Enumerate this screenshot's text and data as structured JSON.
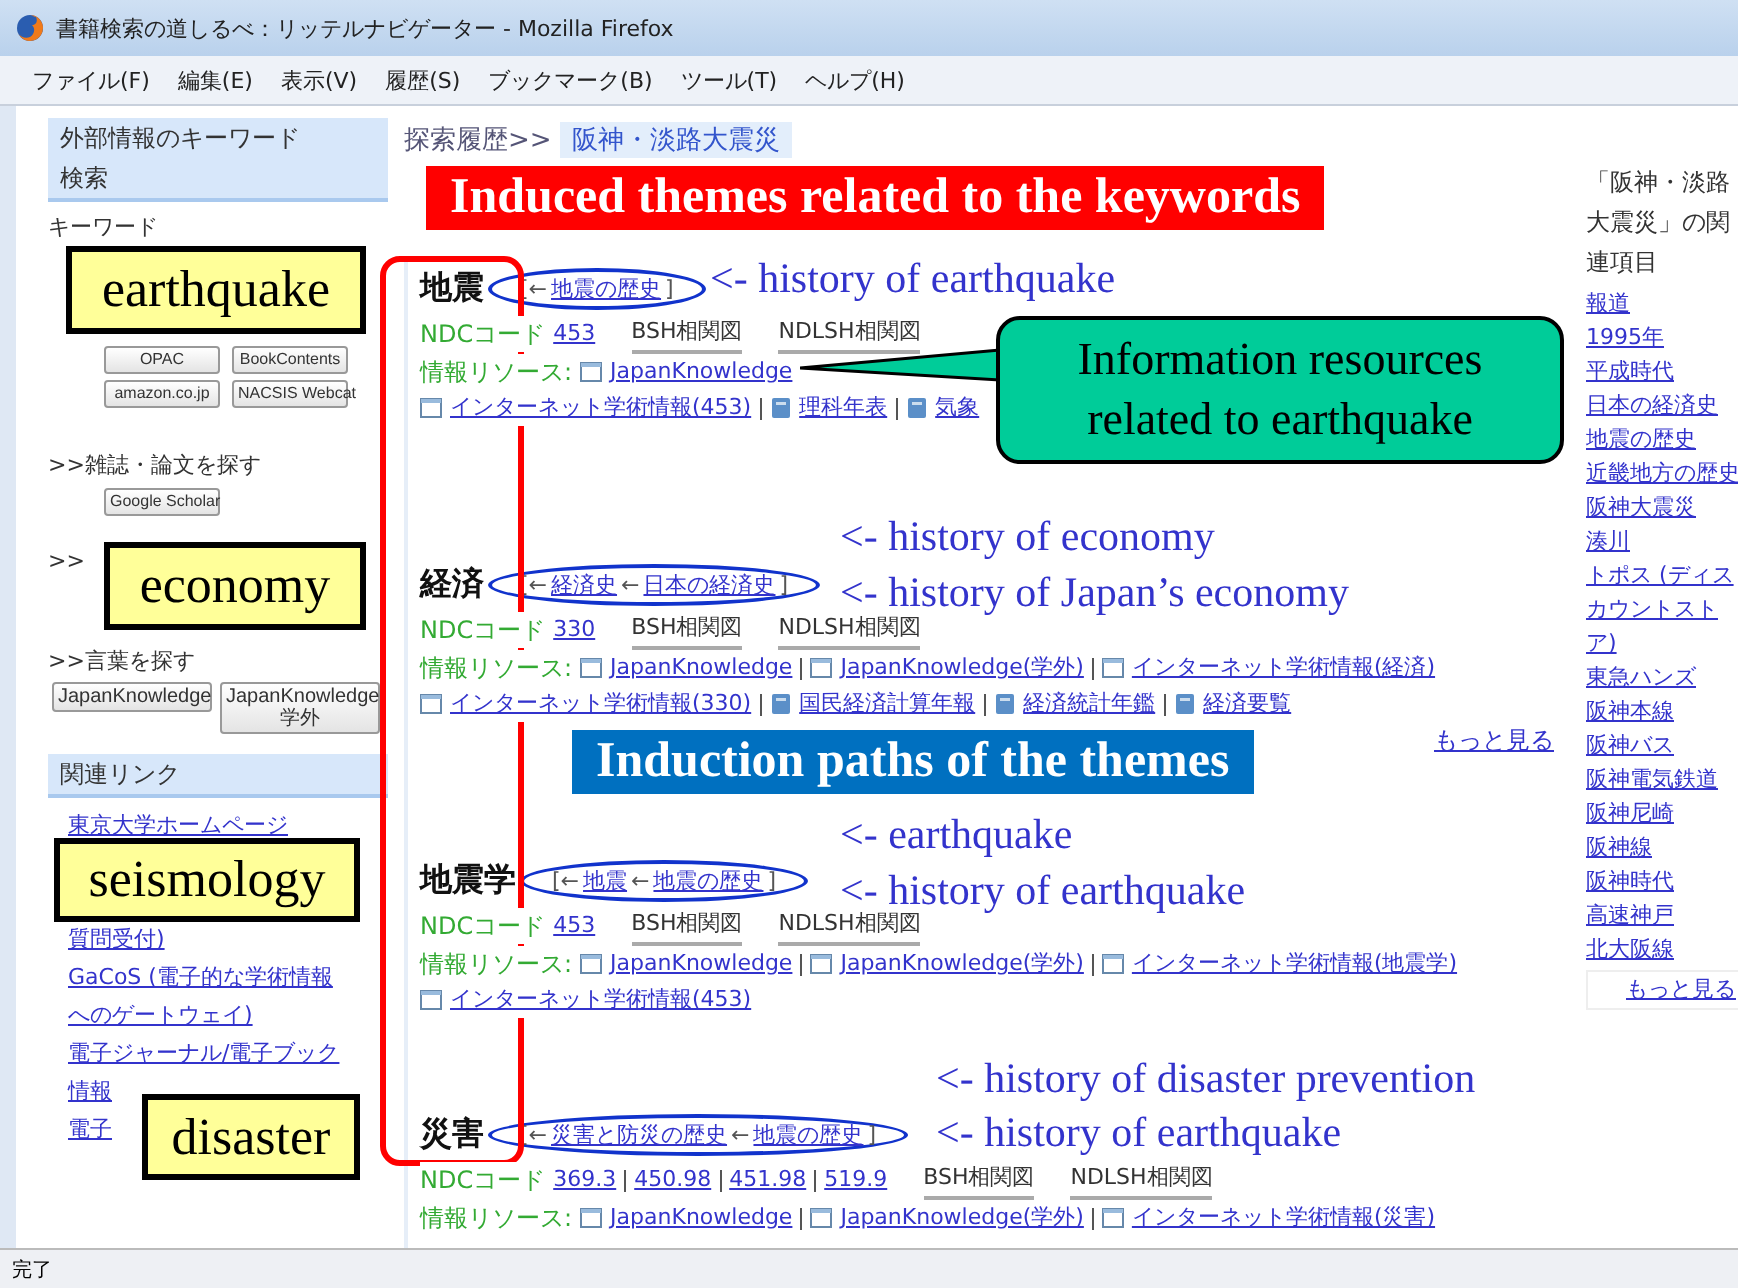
{
  "window": {
    "title": "書籍検索の道しるべ：リッテルナビゲーター - Mozilla Firefox"
  },
  "menu": [
    "ファイル(F)",
    "編集(E)",
    "表示(V)",
    "履歴(S)",
    "ブックマーク(B)",
    "ツール(T)",
    "ヘルプ(H)"
  ],
  "sidebar": {
    "search_heading": "外部情報のキーワード検索",
    "keyword_label": "キーワード",
    "catalog_buttons": [
      "OPAC",
      "BookContents",
      "amazon.co.jp",
      "NACSIS Webcat"
    ],
    "article_label": ">>雑誌・論文を探す",
    "article_buttons": [
      "Google Scholar"
    ],
    "hidden_label": ">>",
    "word_label": ">>言葉を探す",
    "word_buttons": [
      "JapanKnowledge",
      "JapanKnowledge 学外"
    ],
    "links_heading": "関連リンク",
    "links": [
      "東京大学ホームページ",
      "質問受付)",
      "GaCoS (電子的な学術情報へのゲートウェイ)",
      "電子ジャーナル/電子ブック",
      "情報",
      "電子"
    ]
  },
  "main": {
    "breadcrumb": {
      "label": "探索履歴>>",
      "current": "阪神・淡路大震災"
    },
    "themes": [
      {
        "name": "地震",
        "path": [
          {
            "kind": "text",
            "text": "[←"
          },
          {
            "kind": "link",
            "text": "地震の歴史"
          },
          {
            "kind": "text",
            "text": "]"
          }
        ],
        "ndc_label": "NDCコード",
        "ndc_codes": [
          "453"
        ],
        "maps": [
          "BSH相関図",
          "NDLSH相関図"
        ],
        "resources_label": "情報リソース:",
        "resource_lines": [
          [
            {
              "kind": "web",
              "label": "JapanKnowledge"
            }
          ],
          [
            {
              "kind": "web",
              "label": "インターネット学術情報(453)"
            },
            {
              "kind": "book",
              "label": "理科年表"
            },
            {
              "kind": "book",
              "label": "気象"
            }
          ]
        ]
      },
      {
        "name": "経済",
        "path": [
          {
            "kind": "text",
            "text": "[←"
          },
          {
            "kind": "link",
            "text": "経済史"
          },
          {
            "kind": "text",
            "text": "←"
          },
          {
            "kind": "link",
            "text": "日本の経済史"
          },
          {
            "kind": "text",
            "text": "]"
          }
        ],
        "ndc_label": "NDCコード",
        "ndc_codes": [
          "330"
        ],
        "maps": [
          "BSH相関図",
          "NDLSH相関図"
        ],
        "resources_label": "情報リソース:",
        "resource_lines": [
          [
            {
              "kind": "web",
              "label": "JapanKnowledge"
            },
            {
              "kind": "web",
              "label": "JapanKnowledge(学外)"
            },
            {
              "kind": "web",
              "label": "インターネット学術情報(経済)"
            }
          ],
          [
            {
              "kind": "web",
              "label": "インターネット学術情報(330)"
            },
            {
              "kind": "book",
              "label": "国民経済計算年報"
            },
            {
              "kind": "book",
              "label": "経済統計年鑑"
            },
            {
              "kind": "book",
              "label": "経済要覧"
            }
          ]
        ],
        "more": "もっと見る"
      },
      {
        "name": "地震学",
        "path": [
          {
            "kind": "text",
            "text": "[←"
          },
          {
            "kind": "link",
            "text": "地震"
          },
          {
            "kind": "text",
            "text": "←"
          },
          {
            "kind": "link",
            "text": "地震の歴史"
          },
          {
            "kind": "text",
            "text": "]"
          }
        ],
        "ndc_label": "NDCコード",
        "ndc_codes": [
          "453"
        ],
        "maps": [
          "BSH相関図",
          "NDLSH相関図"
        ],
        "resources_label": "情報リソース:",
        "resource_lines": [
          [
            {
              "kind": "web",
              "label": "JapanKnowledge"
            },
            {
              "kind": "web",
              "label": "JapanKnowledge(学外)"
            },
            {
              "kind": "web",
              "label": "インターネット学術情報(地震学)"
            }
          ],
          [
            {
              "kind": "web",
              "label": "インターネット学術情報(453)"
            }
          ]
        ]
      },
      {
        "name": "災害",
        "path": [
          {
            "kind": "text",
            "text": "[←"
          },
          {
            "kind": "link",
            "text": "災害と防災の歴史"
          },
          {
            "kind": "text",
            "text": "←"
          },
          {
            "kind": "link",
            "text": "地震の歴史"
          },
          {
            "kind": "text",
            "text": "]"
          }
        ],
        "ndc_label": "NDCコード",
        "ndc_codes": [
          "369.3",
          "450.98",
          "451.98",
          "519.9"
        ],
        "maps": [
          "BSH相関図",
          "NDLSH相関図"
        ],
        "resources_label": "情報リソース:",
        "resource_lines": [
          [
            {
              "kind": "web",
              "label": "JapanKnowledge"
            },
            {
              "kind": "web",
              "label": "JapanKnowledge(学外)"
            },
            {
              "kind": "web",
              "label": "インターネット学術情報(災害)"
            }
          ]
        ]
      }
    ]
  },
  "related": {
    "heading": "「阪神・淡路大震災」の関連項目",
    "items": [
      "報道",
      "1995年",
      "平成時代",
      "日本の経済史",
      "地震の歴史",
      "近畿地方の歴史",
      "阪神大震災",
      "湊川",
      "トポス (ディスカウントストア)",
      "東急ハンズ",
      "阪神本線",
      "阪神バス",
      "阪神電気鉄道",
      "阪神尼崎",
      "阪神線",
      "阪神時代",
      "高速神戸",
      "北大阪線"
    ],
    "more": "もっと見る"
  },
  "annotations": {
    "banners": [
      {
        "kind": "red",
        "text": "Induced themes related to the keywords"
      },
      {
        "kind": "blue",
        "text": "Induction paths of the themes"
      }
    ],
    "callout": "Information resources related to earthquake",
    "notes": [
      "<- history of earthquake",
      "<- history of economy",
      "<- history of Japan’s economy",
      "<- earthquake",
      "<- history of  earthquake",
      "<- history of disaster prevention",
      "<- history of  earthquake"
    ],
    "keywords": [
      "earthquake",
      "economy",
      "seismology",
      "disaster"
    ]
  },
  "status_bar": "完了"
}
